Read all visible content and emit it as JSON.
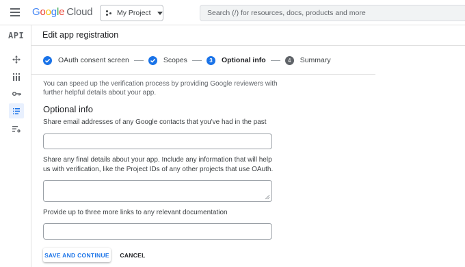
{
  "topbar": {
    "logo": {
      "g1": "G",
      "o1": "o",
      "o2": "o",
      "g2": "g",
      "l": "l",
      "e": "e",
      "cloud": "Cloud"
    },
    "project_label": "My Project",
    "search_placeholder": "Search (/) for resources, docs, products and more"
  },
  "rail": {
    "product_label": "API",
    "icons": [
      "move-icon",
      "dashboard-grid-icon",
      "key-icon",
      "consent-list-icon",
      "settings-list-icon"
    ],
    "active_icon": "consent-list-icon"
  },
  "header": {
    "title": "Edit app registration"
  },
  "stepper": {
    "steps": [
      {
        "number": "1",
        "label": "OAuth consent screen",
        "state": "done"
      },
      {
        "number": "2",
        "label": "Scopes",
        "state": "done"
      },
      {
        "number": "3",
        "label": "Optional info",
        "state": "current"
      },
      {
        "number": "4",
        "label": "Summary",
        "state": "todo"
      }
    ]
  },
  "form": {
    "intro": "You can speed up the verification process by providing Google reviewers with further helpful details about your app.",
    "section_title": "Optional info",
    "fields": [
      {
        "label": "Share email addresses of any Google contacts that you've had in the past",
        "value": ""
      },
      {
        "label": "Share any final details about your app. Include any information that will help us with verification, like the Project IDs of any other projects that use OAuth.",
        "value": ""
      },
      {
        "label": "Provide up to three more links to any relevant documentation",
        "value": ""
      }
    ],
    "primary_button": "SAVE AND CONTINUE",
    "cancel_button": "CANCEL"
  },
  "colors": {
    "accent": "#1a73e8",
    "active_rail_bg": "#e8f0fe",
    "text_primary": "#202124",
    "text_secondary": "#5f6368"
  }
}
